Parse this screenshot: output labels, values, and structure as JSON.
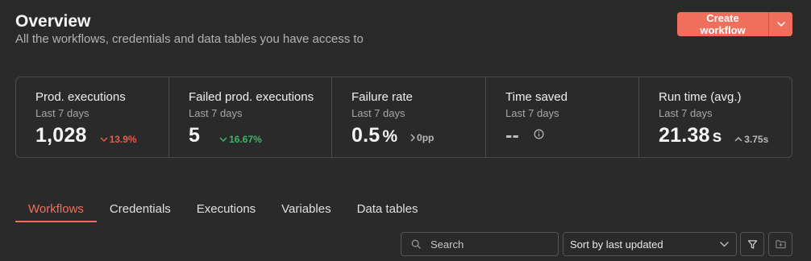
{
  "header": {
    "title": "Overview",
    "subtitle": "All the workflows, credentials and data tables you have access to",
    "create_button_label": "Create workflow"
  },
  "stats": [
    {
      "title": "Prod. executions",
      "period": "Last 7 days",
      "value": "1,028",
      "unit": "",
      "delta": "13.9%",
      "delta_direction": "down",
      "delta_status": "bad"
    },
    {
      "title": "Failed prod. executions",
      "period": "Last 7 days",
      "value": "5",
      "unit": "",
      "delta": "16.67%",
      "delta_direction": "down",
      "delta_status": "good"
    },
    {
      "title": "Failure rate",
      "period": "Last 7 days",
      "value": "0.5",
      "unit": "%",
      "delta": "0pp",
      "delta_direction": "neutral",
      "delta_status": "neutral"
    },
    {
      "title": "Time saved",
      "period": "Last 7 days",
      "value": "--",
      "unit": "",
      "delta": "",
      "icon": "info-icon"
    },
    {
      "title": "Run time (avg.)",
      "period": "Last 7 days",
      "value": "21.38",
      "unit": "s",
      "delta": "3.75s",
      "delta_direction": "up",
      "delta_status": "neutral"
    }
  ],
  "tabs": [
    {
      "label": "Workflows",
      "active": true
    },
    {
      "label": "Credentials",
      "active": false
    },
    {
      "label": "Executions",
      "active": false
    },
    {
      "label": "Variables",
      "active": false
    },
    {
      "label": "Data tables",
      "active": false
    }
  ],
  "toolbar": {
    "search_placeholder": "Search",
    "search_value": "",
    "sort_value": "Sort by last updated"
  },
  "colors": {
    "accent": "#f06f5c",
    "background": "#2a2a2a",
    "delta_bad": "#ea5a4a",
    "delta_good": "#3db368"
  }
}
